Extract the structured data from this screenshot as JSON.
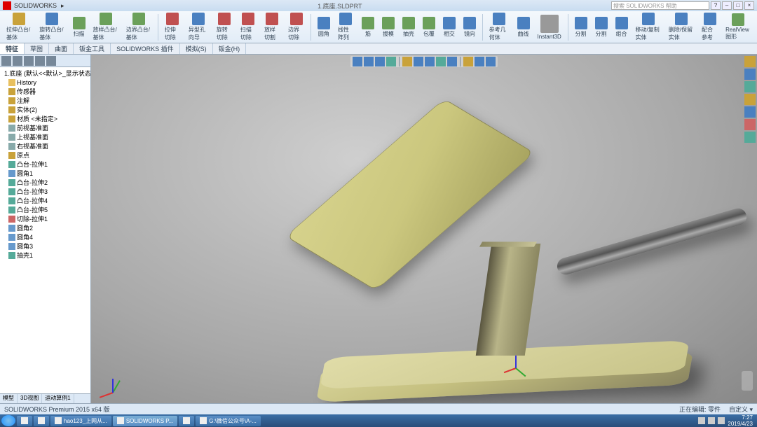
{
  "app_name": "SOLIDWORKS",
  "document_title": "1.底座.SLDPRT",
  "search_placeholder": "搜索 SOLIDWORKS 帮助",
  "ribbon": {
    "items": [
      {
        "label": "拉伸凸台/基体",
        "icon": "y"
      },
      {
        "label": "旋转凸台/基体",
        "icon": "b"
      },
      {
        "label": "扫描",
        "icon": "g"
      },
      {
        "label": "放样凸台/基体",
        "icon": "g"
      },
      {
        "label": "边界凸台/基体",
        "icon": "g"
      },
      {
        "label": "拉伸切除",
        "icon": "r"
      },
      {
        "label": "异型孔向导",
        "icon": "b"
      },
      {
        "label": "旋转切除",
        "icon": "r"
      },
      {
        "label": "扫描切除",
        "icon": "r"
      },
      {
        "label": "放样切割",
        "icon": "r"
      },
      {
        "label": "边界切除",
        "icon": "r"
      },
      {
        "label": "圆角",
        "icon": "b"
      },
      {
        "label": "线性阵列",
        "icon": "b"
      },
      {
        "label": "筋",
        "icon": "g"
      },
      {
        "label": "拔模",
        "icon": "g"
      },
      {
        "label": "抽壳",
        "icon": "g"
      },
      {
        "label": "包覆",
        "icon": "g"
      },
      {
        "label": "相交",
        "icon": "b"
      },
      {
        "label": "镜向",
        "icon": "b"
      },
      {
        "label": "参考几何体",
        "icon": "b"
      },
      {
        "label": "曲线",
        "icon": "b"
      },
      {
        "label": "Instant3D",
        "icon": "gr"
      },
      {
        "label": "分割",
        "icon": "b"
      },
      {
        "label": "分割",
        "icon": "b"
      },
      {
        "label": "组合",
        "icon": "b"
      },
      {
        "label": "移动/复制实体",
        "icon": "b"
      },
      {
        "label": "删除/保留实体",
        "icon": "b"
      },
      {
        "label": "配合参考",
        "icon": "b"
      },
      {
        "label": "RealView图形",
        "icon": "g"
      }
    ]
  },
  "tabs": [
    "特征",
    "草图",
    "曲面",
    "钣金工具",
    "SOLIDWORKS 插件",
    "模拟(S)",
    "钣金(H)"
  ],
  "active_tab": 0,
  "tree": {
    "root": "1.底座  (默认<<默认>_显示状态 1",
    "items": [
      {
        "icon": "fold",
        "label": "History"
      },
      {
        "icon": "doc",
        "label": "传感器"
      },
      {
        "icon": "doc",
        "label": "注解"
      },
      {
        "icon": "doc",
        "label": "实体(2)"
      },
      {
        "icon": "doc",
        "label": "材质 <未指定>"
      },
      {
        "icon": "plane",
        "label": "前视基准面"
      },
      {
        "icon": "plane",
        "label": "上视基准面"
      },
      {
        "icon": "plane",
        "label": "右视基准面"
      },
      {
        "icon": "doc",
        "label": "原点"
      },
      {
        "icon": "feat",
        "label": "凸台-拉伸1"
      },
      {
        "icon": "fill",
        "label": "圆角1"
      },
      {
        "icon": "feat",
        "label": "凸台-拉伸2"
      },
      {
        "icon": "feat",
        "label": "凸台-拉伸3"
      },
      {
        "icon": "feat",
        "label": "凸台-拉伸4"
      },
      {
        "icon": "feat",
        "label": "凸台-拉伸5"
      },
      {
        "icon": "cut",
        "label": "切除-拉伸1"
      },
      {
        "icon": "fill",
        "label": "圆角2"
      },
      {
        "icon": "fill",
        "label": "圆角4"
      },
      {
        "icon": "fill",
        "label": "圆角3"
      },
      {
        "icon": "feat",
        "label": "抽壳1"
      }
    ]
  },
  "sidebar_tabs": [
    "模型",
    "3D视图",
    "运动算例1"
  ],
  "status": {
    "left": "SOLIDWORKS Premium 2015 x64 版",
    "right": [
      "正在编辑: 零件",
      "自定义 ▾"
    ]
  },
  "taskbar": {
    "items": [
      {
        "label": ""
      },
      {
        "label": ""
      },
      {
        "label": "hao123_上网从..."
      },
      {
        "label": "SOLIDWORKS P..."
      },
      {
        "label": ""
      },
      {
        "label": "G:\\微信公众号\\A-..."
      }
    ],
    "active": 3,
    "time": "7:27",
    "date": "2019/4/23"
  }
}
